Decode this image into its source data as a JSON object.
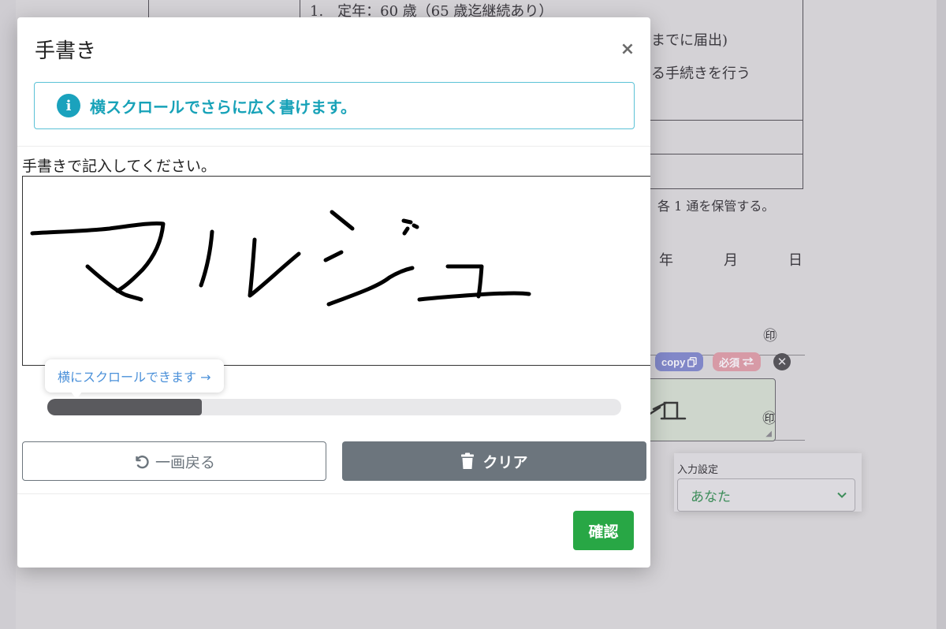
{
  "background": {
    "doc_lines": [
      {
        "text": "1.　定年：60 歳（65 歳迄継続あり）"
      },
      {
        "text": "までに届出)"
      },
      {
        "text": "る手続きを行う"
      },
      {
        "text": "、各 1 通を保管する。"
      },
      {
        "text": "年"
      },
      {
        "text": "月"
      },
      {
        "text": "日"
      },
      {
        "text": "㊞"
      },
      {
        "text": "㊞"
      }
    ],
    "tags": {
      "copy_label": "copy",
      "required_label": "必須",
      "remove_symbol": "✕"
    },
    "input_settings": {
      "label": "入力設定",
      "selected": "あなた"
    }
  },
  "modal": {
    "title": "手書き",
    "close_symbol": "×",
    "info_icon_glyph": "i",
    "info_text": "横スクロールでさらに広く書けます。",
    "canvas_label": "手書きで記入してください。",
    "handwritten_text": "マルジュ",
    "tooltip_text": "横にスクロールできます →",
    "scroll_position_fraction": 0.27,
    "undo_label": "一画戻る",
    "clear_label": "クリア",
    "confirm_label": "確認"
  },
  "colors": {
    "info": "#17a2b8",
    "secondary": "#6c757d",
    "success": "#28a745",
    "tooltip_link": "#4a90d9"
  }
}
